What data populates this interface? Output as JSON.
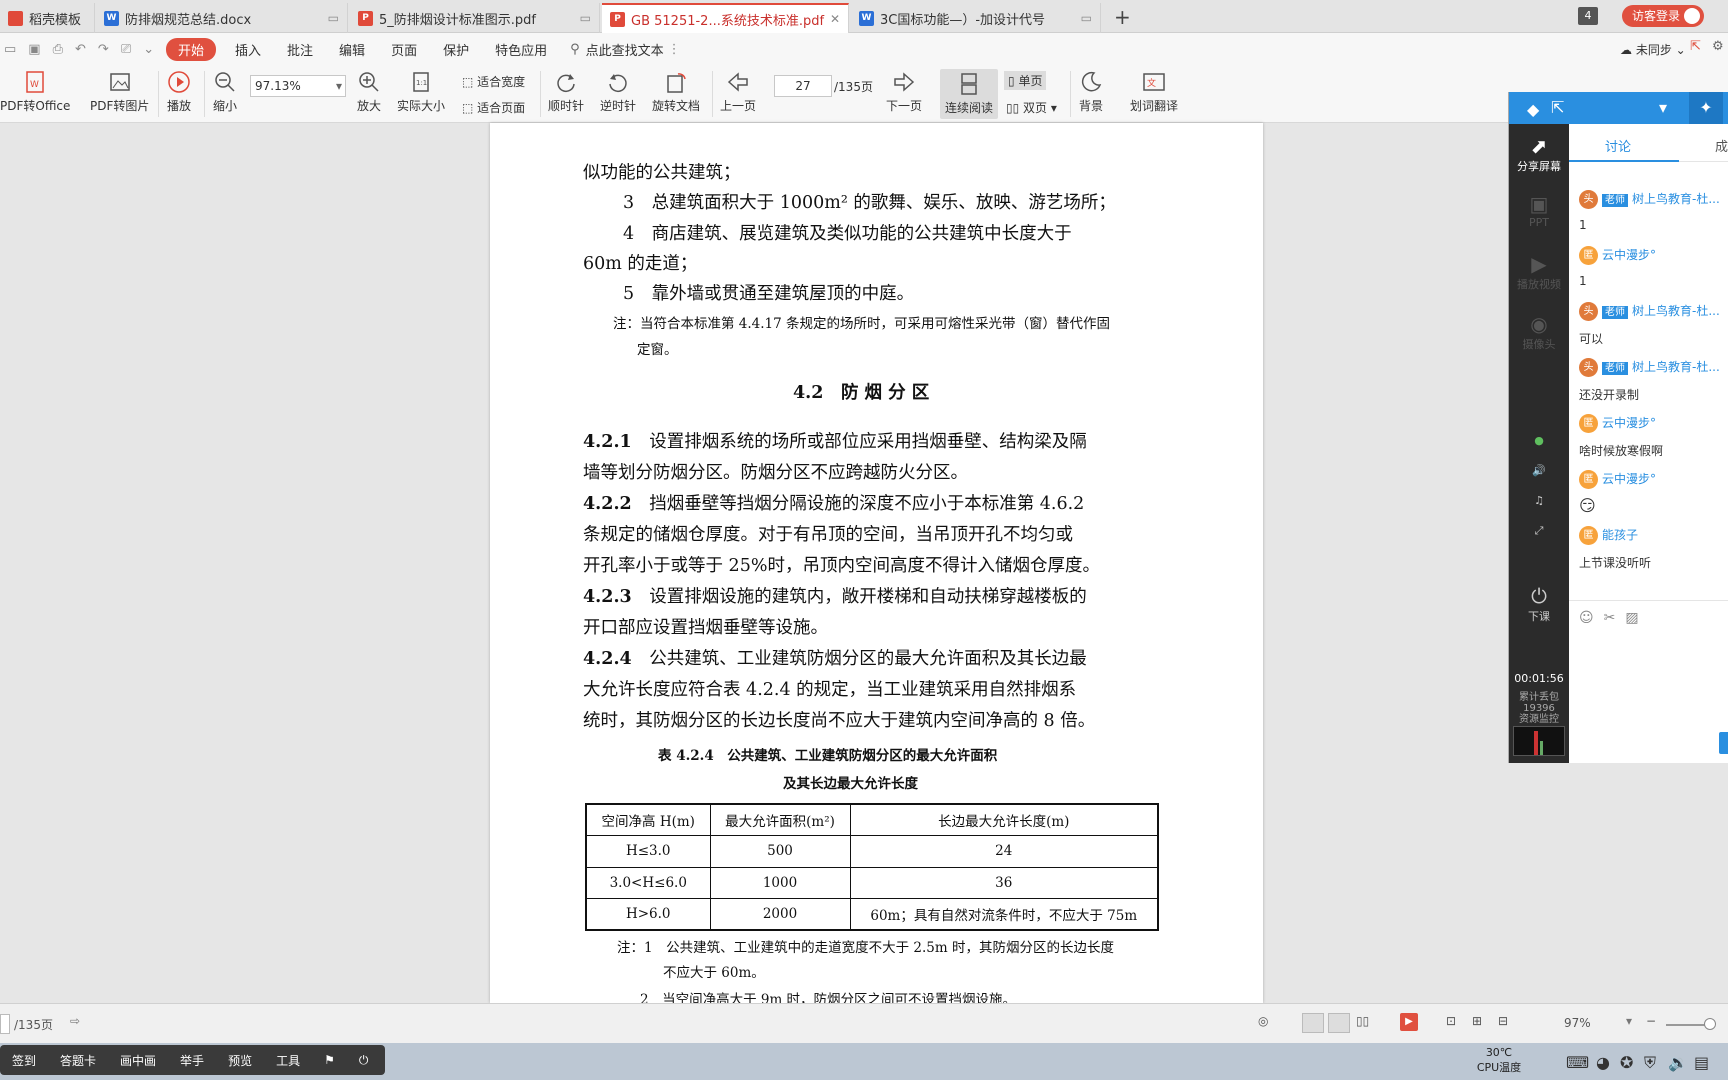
{
  "tabs": [
    {
      "label": "稻壳模板",
      "icon": "wps-docer-icon",
      "color": "#e04a3a"
    },
    {
      "label": "防排烟规范总结.docx",
      "icon": "word-doc-icon",
      "color": "#2b6fd6"
    },
    {
      "label": "5_防排烟设计标准图示.pdf",
      "icon": "pdf-icon",
      "color": "#e04a3a"
    },
    {
      "label": "GB 51251-2...系统技术标准.pdf",
      "icon": "pdf-icon",
      "color": "#e04a3a"
    },
    {
      "label": "3C国标功能—）-加设计代号",
      "icon": "word-doc-icon",
      "color": "#2b6fd6"
    }
  ],
  "tab_count": "4",
  "login_label": "访客登录",
  "menu": [
    "开始",
    "插入",
    "批注",
    "编辑",
    "页面",
    "保护",
    "特色应用"
  ],
  "search_placeholder": "点此查找文本",
  "sync_label": "未同步",
  "toolbar": {
    "pdf_to_office": "PDF转Office",
    "pdf_to_image": "PDF转图片",
    "play": "播放",
    "zoom_out": "缩小",
    "zoom_value": "97.13%",
    "zoom_in": "放大",
    "actual_size": "实际大小",
    "fit_width": "适合宽度",
    "fit_page": "适合页面",
    "rotate_cw": "顺时针",
    "rotate_ccw": "逆时针",
    "rotate_doc": "旋转文档",
    "prev_page": "上一页",
    "page_input": "27",
    "page_total": "/135页",
    "next_page": "下一页",
    "continuous": "连续阅读",
    "single": "单页",
    "double": "双页",
    "background": "背景",
    "translate": "划词翻译"
  },
  "doc": {
    "l1": "似功能的公共建筑；",
    "l2": "3　总建筑面积大于 1000m² 的歌舞、娱乐、放映、游艺场所；",
    "l3": "4　商店建筑、展览建筑及类似功能的公共建筑中长度大于",
    "l4": "60m 的走道；",
    "l5": "5　靠外墙或贯通至建筑屋顶的中庭。",
    "n1": "注：当符合本标准第 4.4.17 条规定的场所时，可采用可熔性采光带（窗）替代作固",
    "n2": "定窗。",
    "heading": "4.2　防 烟 分 区",
    "p1a_num": "4.2.1",
    "p1a": "设置排烟系统的场所或部位应采用挡烟垂壁、结构梁及隔",
    "p1b": "墙等划分防烟分区。防烟分区不应跨越防火分区。",
    "p2a_num": "4.2.2",
    "p2a": "挡烟垂壁等挡烟分隔设施的深度不应小于本标准第 4.6.2",
    "p2b": "条规定的储烟仓厚度。对于有吊顶的空间，当吊顶开孔不均匀或",
    "p2c": "开孔率小于或等于 25%时，吊顶内空间高度不得计入储烟仓厚度。",
    "p3a_num": "4.2.3",
    "p3a": "设置排烟设施的建筑内，敞开楼梯和自动扶梯穿越楼板的",
    "p3b": "开口部应设置挡烟垂壁等设施。",
    "p4a_num": "4.2.4",
    "p4a": "公共建筑、工业建筑防烟分区的最大允许面积及其长边最",
    "p4b": "大允许长度应符合表 4.2.4 的规定，当工业建筑采用自然排烟系",
    "p4c": "统时，其防烟分区的长边长度尚不应大于建筑内空间净高的 8 倍。",
    "table_title1": "表 4.2.4　公共建筑、工业建筑防烟分区的最大允许面积",
    "table_title2": "及其长边最大允许长度",
    "table": {
      "headers": [
        "空间净高 H(m)",
        "最大允许面积(m²)",
        "长边最大允许长度(m)"
      ],
      "rows": [
        [
          "H≤3.0",
          "500",
          "24"
        ],
        [
          "3.0<H≤6.0",
          "1000",
          "36"
        ],
        [
          "H>6.0",
          "2000",
          "60m；具有自然对流条件时，不应大于 75m"
        ]
      ]
    },
    "note1a": "注：1　公共建筑、工业建筑中的走道宽度不大于 2.5m 时，其防烟分区的长边长度",
    "note1b": "不应大于 60m。",
    "note2": "2　当空间净高大于 9m 时，防烟分区之间可不设置挡烟设施。"
  },
  "status": {
    "page_label": "/135页",
    "zoom": "97%"
  },
  "classbar": [
    "签到",
    "答题卡",
    "画中画",
    "举手",
    "预览",
    "工具"
  ],
  "tray": {
    "temp": "30℃",
    "cpu": "CPU温度"
  },
  "side": {
    "nav": [
      "分享屏幕",
      "PPT",
      "播放视频",
      "摄像头",
      "下课"
    ],
    "tab_discuss": "讨论",
    "tab_other": "成",
    "messages": [
      {
        "role": "老师",
        "name": "树上鸟教育-杜...",
        "text": "1"
      },
      {
        "role": "",
        "name": "云中漫步°",
        "text": "1"
      },
      {
        "role": "老师",
        "name": "树上鸟教育-杜...",
        "text": "可以"
      },
      {
        "role": "老师",
        "name": "树上鸟教育-杜...",
        "text": "还没开录制"
      },
      {
        "role": "",
        "name": "云中漫步°",
        "text": "啥时候放寒假啊"
      },
      {
        "role": "",
        "name": "云中漫步°",
        "text": "😏"
      },
      {
        "role": "",
        "name": "能孩子",
        "text": "上节课没听听"
      }
    ],
    "timer": "00:01:56",
    "stat1": "累计丢包",
    "stat2": "19396",
    "stat3": "资源监控"
  }
}
